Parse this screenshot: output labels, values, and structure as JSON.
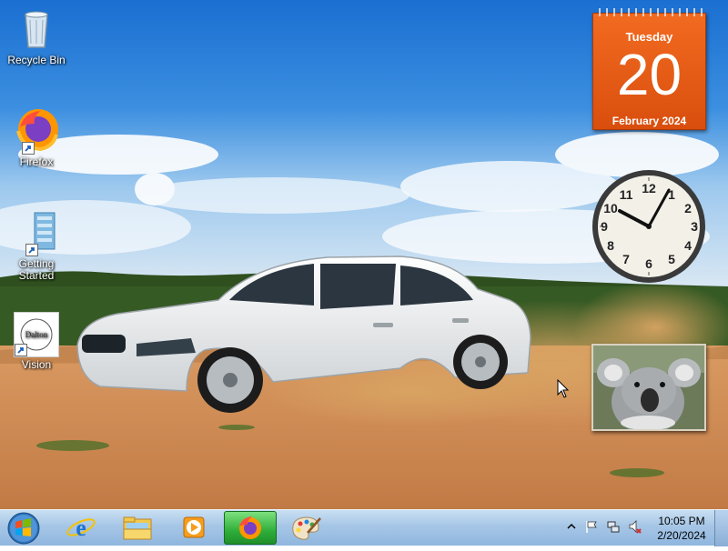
{
  "desktop_icons": [
    {
      "label": "Recycle Bin",
      "icon": "recycle-bin-icon"
    },
    {
      "label": "Firefox",
      "icon": "firefox-icon"
    },
    {
      "label": "Getting\nStarted",
      "icon": "getting-started-icon"
    },
    {
      "label": "Vision",
      "icon": "vision-icon",
      "logo_text": "Dalton"
    }
  ],
  "calendar": {
    "day_name": "Tuesday",
    "date": "20",
    "month_year": "February 2024"
  },
  "clock_gadget": {
    "numbers": [
      "12",
      "1",
      "2",
      "3",
      "4",
      "5",
      "6",
      "7",
      "8",
      "9",
      "10",
      "11"
    ]
  },
  "taskbar": {
    "buttons": [
      {
        "name": "internet-explorer",
        "icon": "ie-icon"
      },
      {
        "name": "windows-explorer",
        "icon": "folder-icon"
      },
      {
        "name": "media-player",
        "icon": "media-player-icon"
      },
      {
        "name": "firefox",
        "icon": "firefox-icon",
        "active": true
      },
      {
        "name": "paint",
        "icon": "paint-palette-icon"
      }
    ],
    "tray": {
      "time": "10:05 PM",
      "date": "2/20/2024"
    }
  },
  "colors": {
    "calendar": "#e85c17",
    "taskbar": "#a6c6e6",
    "active_button": "#2fae3a"
  }
}
